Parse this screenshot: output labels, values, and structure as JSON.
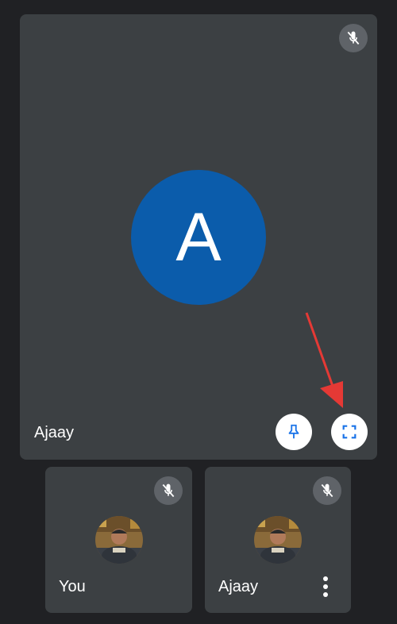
{
  "main_tile": {
    "participant_name": "Ajaay",
    "avatar_letter": "A",
    "avatar_color": "#0b5cab",
    "mic_icon": "mic-off-icon",
    "pin_icon": "pin-icon",
    "fullscreen_icon": "fullscreen-icon"
  },
  "small_tiles": [
    {
      "participant_name": "You",
      "mic_icon": "mic-off-icon"
    },
    {
      "participant_name": "Ajaay",
      "mic_icon": "mic-off-icon",
      "more_icon": "more-vert-icon"
    }
  ],
  "annotation": {
    "arrow_color": "#e53935"
  }
}
